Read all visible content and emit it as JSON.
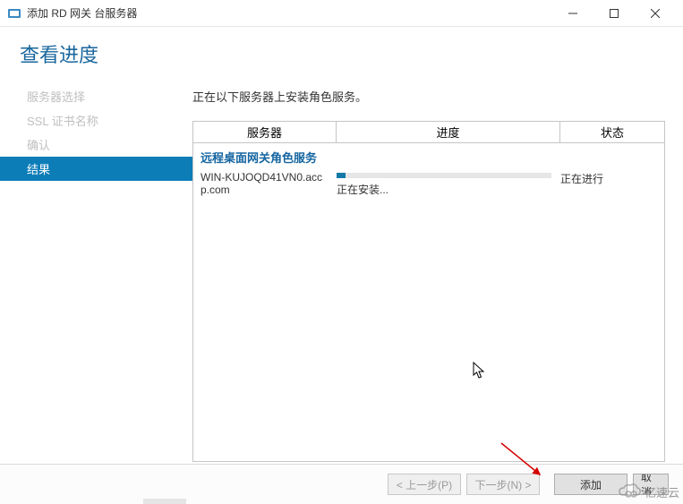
{
  "window": {
    "title": "添加 RD 网关 台服务器"
  },
  "header": {
    "title": "查看进度"
  },
  "sidebar": {
    "items": [
      {
        "label": "服务器选择"
      },
      {
        "label": "SSL 证书名称"
      },
      {
        "label": "确认"
      },
      {
        "label": "结果"
      }
    ]
  },
  "content": {
    "intro": "正在以下服务器上安装角色服务。",
    "columns": {
      "server": "服务器",
      "progress": "进度",
      "status": "状态"
    },
    "group_title": "远程桌面网关角色服务",
    "row": {
      "server": "WIN-KUJOQD41VN0.accp.com",
      "subtext": "正在安装...",
      "status": "正在进行"
    }
  },
  "footer": {
    "prev": "< 上一步(P)",
    "next": "下一步(N) >",
    "add": "添加",
    "cancel": "取消"
  },
  "watermark": {
    "text": "亿速云"
  }
}
